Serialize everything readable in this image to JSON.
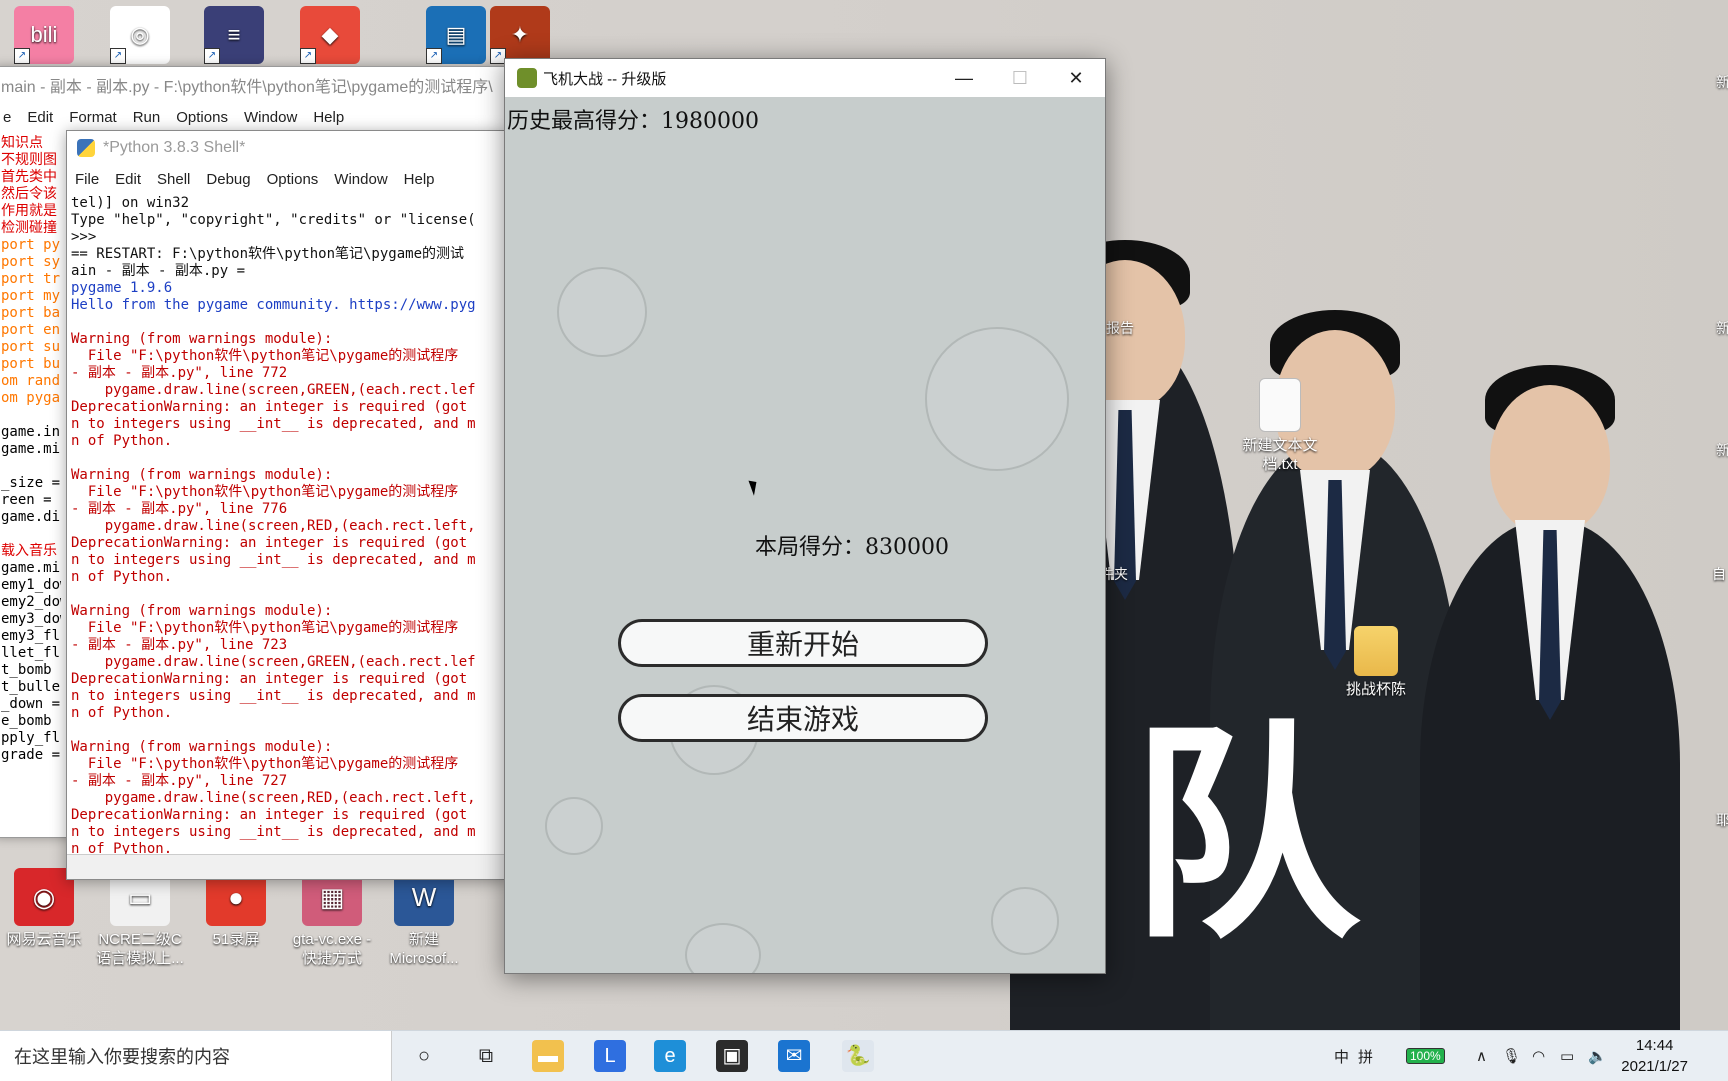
{
  "desktop": {
    "icons_top": [
      {
        "name": "bilibili",
        "color": "#f47fa4",
        "glyph": "bili"
      },
      {
        "name": "baidu-netdisk",
        "color": "#ffffff",
        "glyph": "◎"
      },
      {
        "name": "circuit-app",
        "color": "#3a3f77",
        "glyph": "≡"
      },
      {
        "name": "colorful-app",
        "color": "#e84a3a",
        "glyph": "◆"
      },
      {
        "name": "winrar",
        "color": "#1b6fb6",
        "glyph": "▤"
      },
      {
        "name": "game-shortcut",
        "color": "#b03a1a",
        "glyph": "✦"
      }
    ],
    "icons_bottom": [
      {
        "label": "网易云音乐",
        "color": "#d8272a",
        "glyph": "◉"
      },
      {
        "label": "NCRE二级C\n语言模拟上...",
        "color": "#f1f1f1",
        "glyph": "▭"
      },
      {
        "label": "51录屏",
        "color": "#e23a2b",
        "glyph": "●"
      },
      {
        "label": "gta-vc.exe -\n快捷方式",
        "color": "#d05c7a",
        "glyph": "▦"
      },
      {
        "label": "新建\nMicrosof...",
        "color": "#2b5797",
        "glyph": "W"
      }
    ],
    "icons_right": [
      {
        "label": "新建文本文\n档.txt"
      },
      {
        "label": "挑战杯陈"
      }
    ],
    "partial_labels": [
      "报告",
      "件夹"
    ],
    "edge_chars": [
      "新",
      "新",
      "新",
      "自",
      "耶"
    ],
    "wallpaper_text": "队"
  },
  "editor": {
    "title": "main - 副本 - 副本.py - F:\\python软件\\python笔记\\pygame的测试程序\\",
    "menu": [
      "e",
      "Edit",
      "Format",
      "Run",
      "Options",
      "Window",
      "Help"
    ],
    "code_lines": [
      {
        "t": "知识点",
        "c": "cmt"
      },
      {
        "t": "不规则图",
        "c": "cmt"
      },
      {
        "t": "首先类中",
        "c": "cmt"
      },
      {
        "t": "然后令该",
        "c": "cmt"
      },
      {
        "t": "作用就是",
        "c": "cmt"
      },
      {
        "t": "检测碰撞",
        "c": "cmt"
      },
      {
        "t": "port py",
        "c": "kw"
      },
      {
        "t": "port sy",
        "c": "kw"
      },
      {
        "t": "port tr",
        "c": "kw"
      },
      {
        "t": "port my",
        "c": "kw"
      },
      {
        "t": "port ba",
        "c": "kw"
      },
      {
        "t": "port en",
        "c": "kw"
      },
      {
        "t": "port su",
        "c": "kw"
      },
      {
        "t": "port bu",
        "c": "kw"
      },
      {
        "t": "om rand",
        "c": "kw"
      },
      {
        "t": "om pygai",
        "c": "kw"
      },
      {
        "t": "",
        "c": ""
      },
      {
        "t": "game.in",
        "c": ""
      },
      {
        "t": "game.mi",
        "c": ""
      },
      {
        "t": "",
        "c": ""
      },
      {
        "t": "_size =",
        "c": ""
      },
      {
        "t": "reen = ",
        "c": ""
      },
      {
        "t": "game.di",
        "c": ""
      },
      {
        "t": "",
        "c": ""
      },
      {
        "t": "载入音乐",
        "c": "cmt"
      },
      {
        "t": "game.mi",
        "c": ""
      },
      {
        "t": "emy1_dow",
        "c": ""
      },
      {
        "t": "emy2_dow",
        "c": ""
      },
      {
        "t": "emy3_dow",
        "c": ""
      },
      {
        "t": "emy3_fl",
        "c": ""
      },
      {
        "t": "llet_fl",
        "c": ""
      },
      {
        "t": "t_bomb ",
        "c": ""
      },
      {
        "t": "t_bulle",
        "c": ""
      },
      {
        "t": "_down =",
        "c": ""
      },
      {
        "t": "e_bomb ",
        "c": ""
      },
      {
        "t": "pply_fl",
        "c": ""
      },
      {
        "t": "grade =",
        "c": ""
      }
    ]
  },
  "shell": {
    "title": "*Python 3.8.3 Shell*",
    "menu": [
      "File",
      "Edit",
      "Shell",
      "Debug",
      "Options",
      "Window",
      "Help"
    ],
    "lines": [
      {
        "t": "tel)] on win32",
        "c": ""
      },
      {
        "t": "Type \"help\", \"copyright\", \"credits\" or \"license(",
        "c": ""
      },
      {
        "t": ">>>",
        "c": ""
      },
      {
        "t": "== RESTART: F:\\python软件\\python笔记\\pygame的测试",
        "c": ""
      },
      {
        "t": "ain - 副本 - 副本.py =",
        "c": ""
      },
      {
        "t": "pygame 1.9.6",
        "c": "blue"
      },
      {
        "t": "Hello from the pygame community. https://www.pyg",
        "c": "blue"
      },
      {
        "t": "",
        "c": ""
      },
      {
        "t": "Warning (from warnings module):",
        "c": "red"
      },
      {
        "t": "  File \"F:\\python软件\\python笔记\\pygame的测试程序",
        "c": "red"
      },
      {
        "t": "- 副本 - 副本.py\", line 772",
        "c": "red"
      },
      {
        "t": "    pygame.draw.line(screen,GREEN,(each.rect.lef",
        "c": "red"
      },
      {
        "t": "DeprecationWarning: an integer is required (got",
        "c": "red"
      },
      {
        "t": "n to integers using __int__ is deprecated, and m",
        "c": "red"
      },
      {
        "t": "n of Python.",
        "c": "red"
      },
      {
        "t": "",
        "c": ""
      },
      {
        "t": "Warning (from warnings module):",
        "c": "red"
      },
      {
        "t": "  File \"F:\\python软件\\python笔记\\pygame的测试程序",
        "c": "red"
      },
      {
        "t": "- 副本 - 副本.py\", line 776",
        "c": "red"
      },
      {
        "t": "    pygame.draw.line(screen,RED,(each.rect.left,",
        "c": "red"
      },
      {
        "t": "DeprecationWarning: an integer is required (got",
        "c": "red"
      },
      {
        "t": "n to integers using __int__ is deprecated, and m",
        "c": "red"
      },
      {
        "t": "n of Python.",
        "c": "red"
      },
      {
        "t": "",
        "c": ""
      },
      {
        "t": "Warning (from warnings module):",
        "c": "red"
      },
      {
        "t": "  File \"F:\\python软件\\python笔记\\pygame的测试程序",
        "c": "red"
      },
      {
        "t": "- 副本 - 副本.py\", line 723",
        "c": "red"
      },
      {
        "t": "    pygame.draw.line(screen,GREEN,(each.rect.lef",
        "c": "red"
      },
      {
        "t": "DeprecationWarning: an integer is required (got",
        "c": "red"
      },
      {
        "t": "n to integers using __int__ is deprecated, and m",
        "c": "red"
      },
      {
        "t": "n of Python.",
        "c": "red"
      },
      {
        "t": "",
        "c": ""
      },
      {
        "t": "Warning (from warnings module):",
        "c": "red"
      },
      {
        "t": "  File \"F:\\python软件\\python笔记\\pygame的测试程序",
        "c": "red"
      },
      {
        "t": "- 副本 - 副本.py\", line 727",
        "c": "red"
      },
      {
        "t": "    pygame.draw.line(screen,RED,(each.rect.left,",
        "c": "red"
      },
      {
        "t": "DeprecationWarning: an integer is required (got",
        "c": "red"
      },
      {
        "t": "n to integers using __int__ is deprecated, and m",
        "c": "red"
      },
      {
        "t": "n of Python.",
        "c": "red"
      }
    ]
  },
  "game": {
    "title": "飞机大战 -- 升级版",
    "high_score_label": "历史最高得分：",
    "high_score": "1980000",
    "score_label": "本局得分：",
    "score": "830000",
    "restart_label": "重新开始",
    "quit_label": "结束游戏",
    "controls": {
      "minimize": "—",
      "maximize": "☐",
      "close": "✕"
    }
  },
  "taskbar": {
    "search_placeholder": "在这里输入你要搜索的内容",
    "apps": [
      {
        "name": "cortana-icon",
        "glyph": "○",
        "color": "transparent"
      },
      {
        "name": "task-view-icon",
        "glyph": "⧉",
        "color": "transparent"
      },
      {
        "name": "file-explorer-icon",
        "glyph": "▬",
        "color": "#f2c14e"
      },
      {
        "name": "app-l-icon",
        "glyph": "L",
        "color": "#2f6fe0"
      },
      {
        "name": "edge-icon",
        "glyph": "e",
        "color": "#1e8fd8"
      },
      {
        "name": "store-icon",
        "glyph": "▣",
        "color": "#2b2b2b"
      },
      {
        "name": "mail-icon",
        "glyph": "✉",
        "color": "#1b74d0"
      },
      {
        "name": "python-icon",
        "glyph": "🐍",
        "color": "#dfe6ee"
      }
    ],
    "tray": {
      "input_mode": "中",
      "ime": "拼",
      "battery": "100%",
      "time": "14:44",
      "date": "2021/1/27"
    }
  }
}
